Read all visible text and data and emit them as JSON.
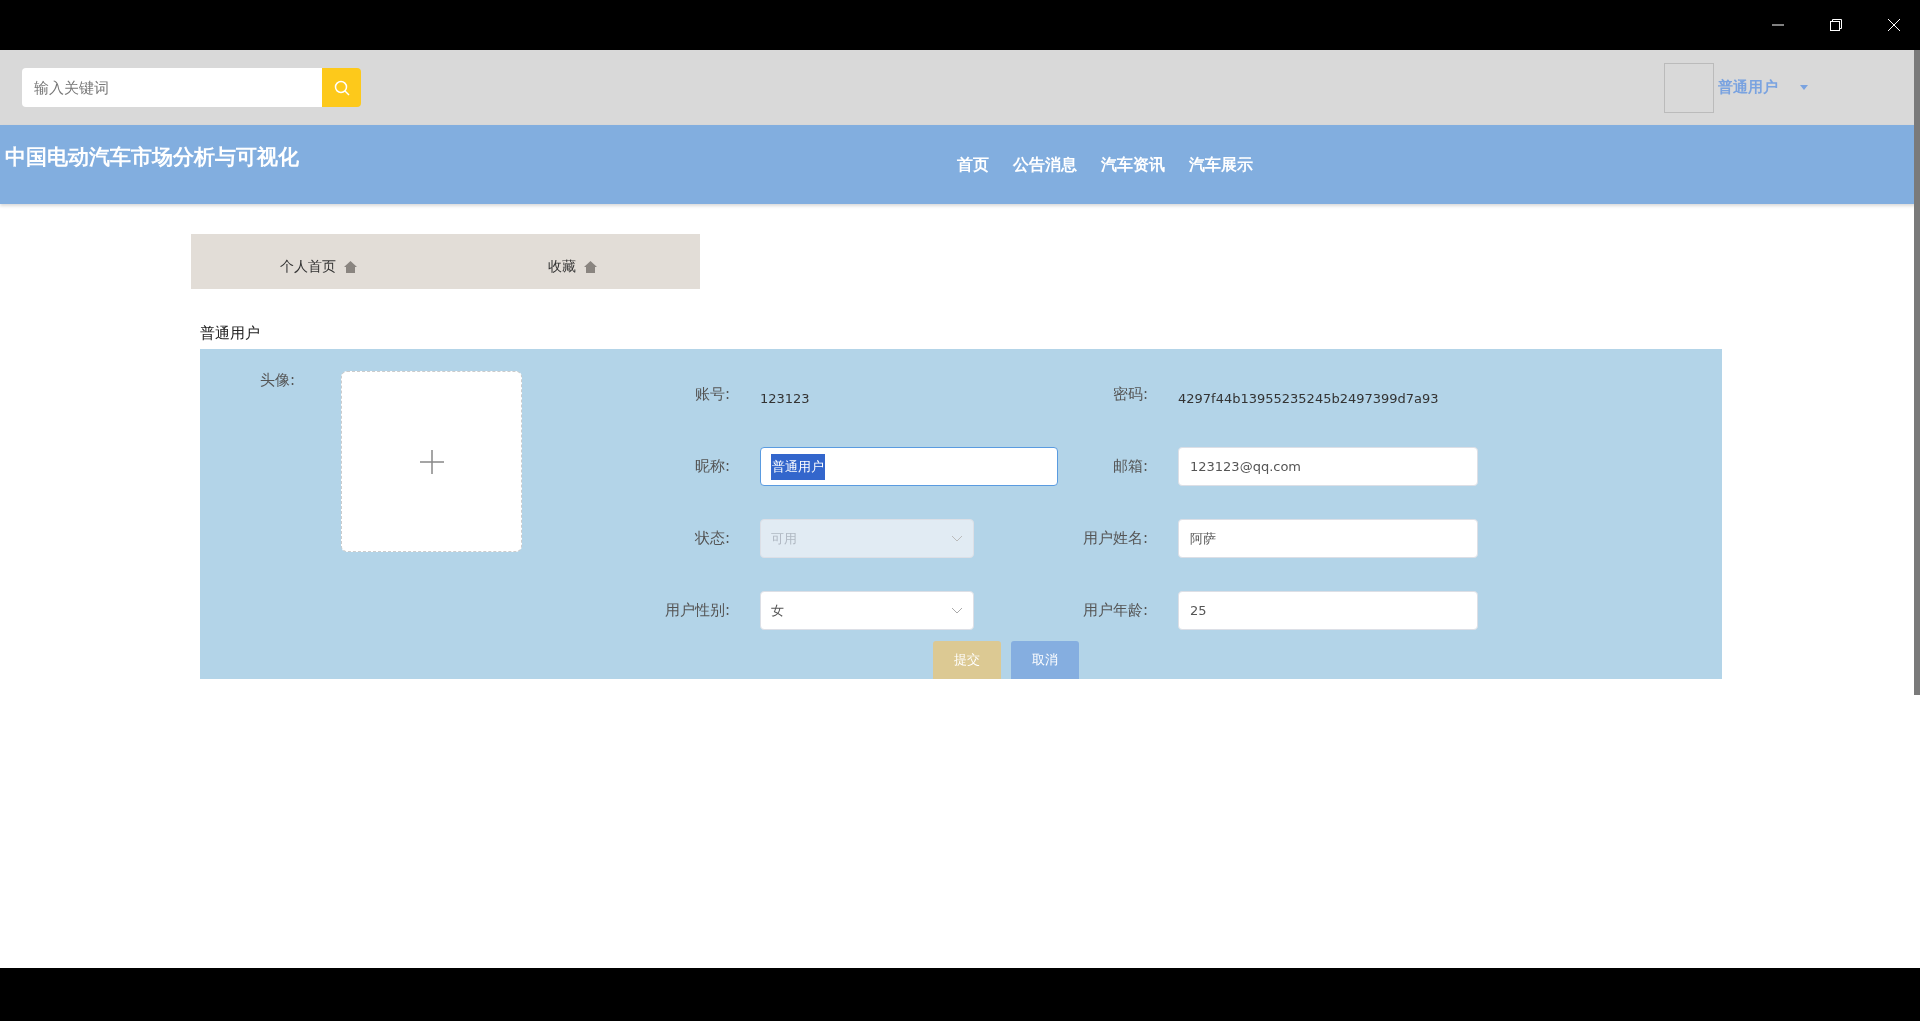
{
  "search": {
    "placeholder": "输入关键词"
  },
  "user_menu": {
    "name": "普通用户"
  },
  "site_title": "中国电动汽车市场分析与可视化",
  "nav": [
    {
      "label": "首页"
    },
    {
      "label": "公告消息"
    },
    {
      "label": "汽车资讯"
    },
    {
      "label": "汽车展示"
    }
  ],
  "tabs": [
    {
      "label": "个人首页"
    },
    {
      "label": "收藏"
    }
  ],
  "section_title": "普通用户",
  "form": {
    "avatar_label": "头像:",
    "fields": [
      {
        "kind": "text",
        "label": "账号:",
        "value": "123123"
      },
      {
        "kind": "text",
        "label": "密码:",
        "value": "4297f44b13955235245b2497399d7a93"
      },
      {
        "kind": "input",
        "label": "昵称:",
        "value": "普通用户",
        "focused": true,
        "text_selected": true
      },
      {
        "kind": "input",
        "label": "邮箱:",
        "value": "123123@qq.com",
        "focused": false,
        "text_selected": false
      },
      {
        "kind": "select",
        "label": "状态:",
        "value": "可用",
        "disabled": true
      },
      {
        "kind": "input",
        "label": "用户姓名:",
        "value": "阿萨",
        "focused": false,
        "text_selected": false
      },
      {
        "kind": "select",
        "label": "用户性别:",
        "value": "女",
        "disabled": false
      },
      {
        "kind": "input",
        "label": "用户年龄:",
        "value": "25",
        "focused": false,
        "text_selected": false
      }
    ],
    "buttons": [
      {
        "kind": "submit",
        "label": "提交"
      },
      {
        "kind": "cancel",
        "label": "取消"
      }
    ]
  }
}
